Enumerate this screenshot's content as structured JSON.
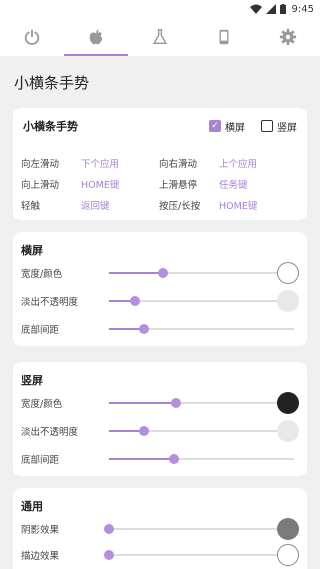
{
  "status": {
    "time": "9:45"
  },
  "tabs": [
    {
      "name": "power",
      "icon": "power-icon"
    },
    {
      "name": "apple",
      "icon": "apple-icon",
      "active": true
    },
    {
      "name": "lab",
      "icon": "flask-icon"
    },
    {
      "name": "device",
      "icon": "phone-icon"
    },
    {
      "name": "settings",
      "icon": "gear-icon"
    }
  ],
  "page_title": "小横条手势",
  "gestures": {
    "title": "小横条手势",
    "landscape_label": "横屏",
    "landscape_checked": true,
    "portrait_label": "竖屏",
    "portrait_checked": false,
    "rows": [
      {
        "l1": "向左滑动",
        "v1": "下个应用",
        "l2": "向右滑动",
        "v2": "上个应用"
      },
      {
        "l1": "向上滑动",
        "v1": "HOME键",
        "l2": "上滑悬停",
        "v2": "任务键"
      },
      {
        "l1": "轻触",
        "v1": "返回键",
        "l2": "按压/长按",
        "v2": "HOME键"
      }
    ]
  },
  "landscape": {
    "title": "横屏",
    "width_label": "宽度/颜色",
    "fade_label": "淡出不透明度",
    "margin_label": "底部间距",
    "width_value": 0.29,
    "fade_value": 0.14,
    "margin_value": 0.19,
    "width_color": "#ffffff",
    "fade_color": "#e8e8e8"
  },
  "portrait": {
    "title": "竖屏",
    "width_label": "宽度/颜色",
    "fade_label": "淡出不透明度",
    "margin_label": "底部间距",
    "width_value": 0.36,
    "fade_value": 0.19,
    "margin_value": 0.35,
    "width_color": "#222222",
    "fade_color": "#e8e8e8"
  },
  "general": {
    "title": "通用",
    "shadow_label": "阴影效果",
    "border_label": "描边效果",
    "shadow_value": 0.0,
    "border_value": 0.0,
    "shadow_color": "#7a7a7a",
    "border_color": "#ffffff"
  },
  "accent": "#a783d4"
}
